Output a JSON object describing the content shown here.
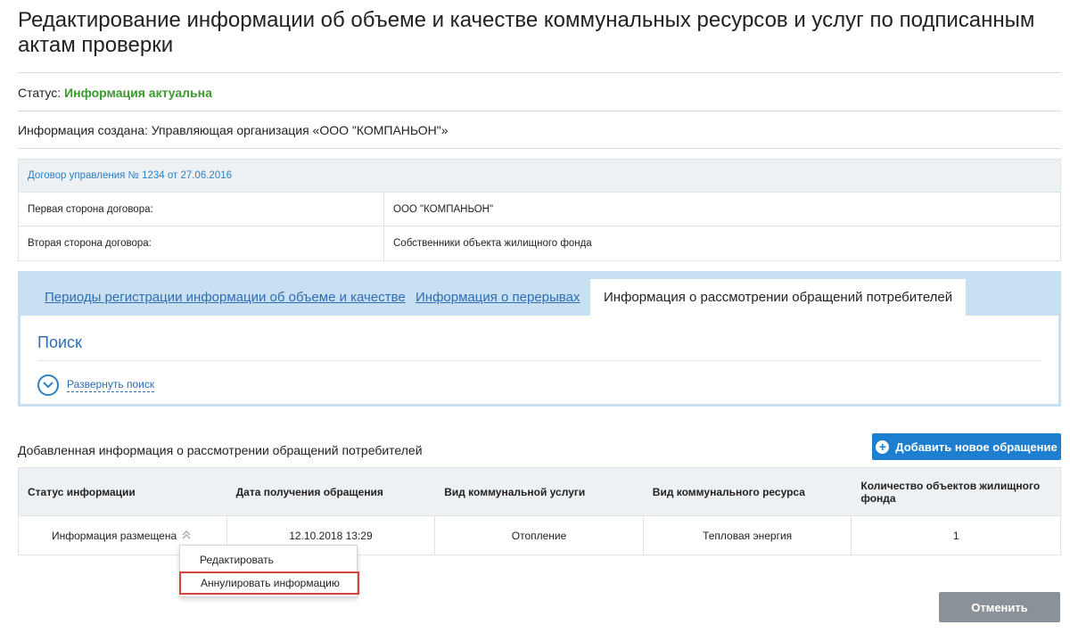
{
  "page": {
    "title": "Редактирование информации об объеме и качестве коммунальных ресурсов и услуг по подписанным актам проверки"
  },
  "status": {
    "label": "Статус:",
    "value": "Информация актуальна",
    "value_color": "#3a9a2f"
  },
  "created": {
    "text": "Информация создана: Управляющая организация «ООО \"КОМПАНЬОН\"»"
  },
  "contract": {
    "header": "Договор управления № 1234 от 27.06.2016",
    "rows": [
      {
        "label": "Первая сторона договора:",
        "value": "ООО \"КОМПАНЬОН\""
      },
      {
        "label": "Вторая сторона договора:",
        "value": "Собственники объекта жилищного фонда"
      }
    ]
  },
  "tabs": [
    {
      "label": "Периоды регистрации информации об объеме и качестве",
      "active": false
    },
    {
      "label": "Информация о перерывах",
      "active": false
    },
    {
      "label": "Информация о рассмотрении обращений потребителей",
      "active": true
    }
  ],
  "search": {
    "title": "Поиск",
    "expand_label": "Развернуть поиск"
  },
  "section": {
    "title": "Добавленная информация о рассмотрении обращений потребителей",
    "add_button": "Добавить новое обращение"
  },
  "table": {
    "columns": [
      "Статус информации",
      "Дата получения обращения",
      "Вид коммунальной услуги",
      "Вид коммунального ресурса",
      "Количество объектов жилищного фонда"
    ],
    "rows": [
      [
        "Информация размещена",
        "12.10.2018 13:29",
        "Отопление",
        "Тепловая энергия",
        "1"
      ]
    ]
  },
  "row_menu": {
    "items": [
      "Редактировать",
      "Аннулировать информацию"
    ],
    "highlighted_item": "Аннулировать информацию",
    "highlight_color": "#d9453b"
  },
  "footer": {
    "cancel_button": "Отменить"
  },
  "colors": {
    "accent": "#1e7fd0",
    "link": "#2f6db3",
    "tabs_bg": "#c9e0f3",
    "cancel_bg": "#8a9199"
  }
}
